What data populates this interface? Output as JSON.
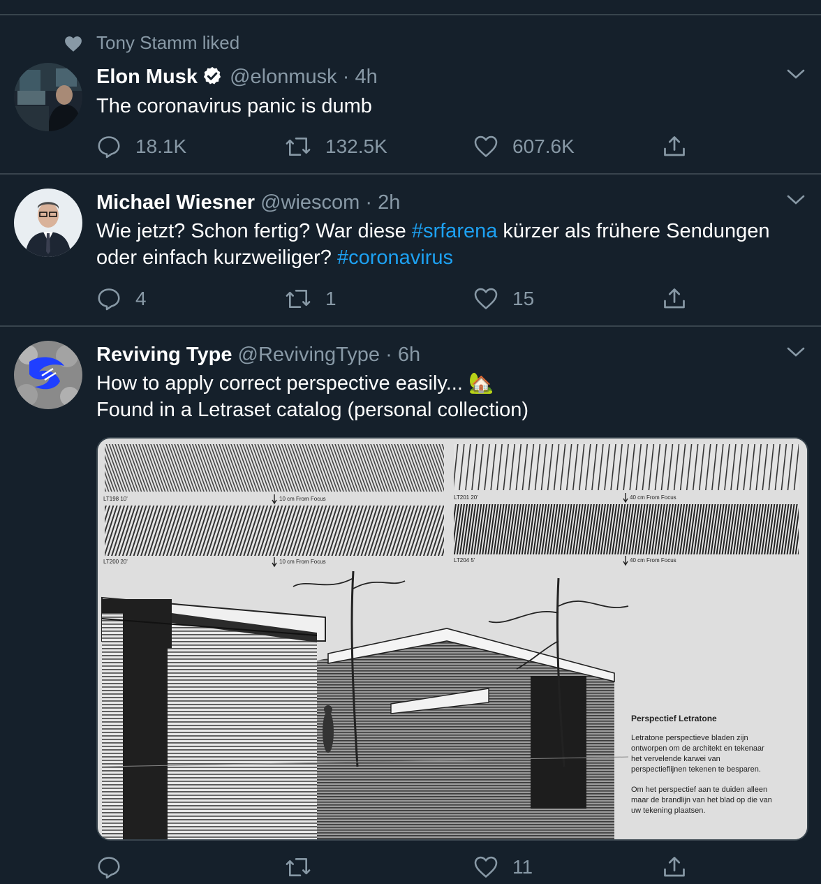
{
  "social_context": {
    "text": "Tony Stamm liked"
  },
  "tweets": [
    {
      "name": "Elon Musk",
      "handle": "@elonmusk",
      "sep": "·",
      "time": "4h",
      "text": "The coronavirus panic is dumb",
      "replies": "18.1K",
      "retweets": "132.5K",
      "likes": "607.6K"
    },
    {
      "name": "Michael Wiesner",
      "handle": "@wiescom",
      "sep": "·",
      "time": "2h",
      "text_a": "Wie jetzt? Schon fertig? War diese ",
      "tag1": "#srfarena",
      "text_b": " kürzer als frühere Sendungen oder einfach kurzweiliger? ",
      "tag2": "#coronavirus",
      "replies": "4",
      "retweets": "1",
      "likes": "15"
    },
    {
      "name": "Reviving Type",
      "handle": "@RevivingType",
      "sep": "·",
      "time": "6h",
      "line1": "How to apply correct perspective easily... 🏡",
      "line2": "Found in a Letraset catalog (personal collection)",
      "replies": "",
      "retweets": "",
      "likes": "11",
      "image": {
        "labels": {
          "lt198": "LT198 10'",
          "lt198_focus": "10 cm From Focus",
          "lt201": "LT201 20'",
          "lt201_focus": "40 cm From Focus",
          "lt200": "LT200 20'",
          "lt200_focus": "10 cm From Focus",
          "lt204": "LT204 5'",
          "lt204_focus": "40 cm From Focus"
        },
        "caption_title": "Perspectief Letratone",
        "caption_p1": [
          "Letratone perspectieve bladen zijn",
          "ontworpen om de architekt en tekenaar",
          "het vervelende karwei van",
          "perspectieflijnen tekenen te besparen."
        ],
        "caption_p2": [
          "Om het perspectief aan te duiden alleen",
          "maar de brandlijn van het blad op die van",
          "uw tekening plaatsen."
        ]
      }
    }
  ],
  "colors": {
    "bg": "#15202b",
    "border": "#38444d",
    "muted": "#8899a6",
    "link": "#1da1f2"
  }
}
